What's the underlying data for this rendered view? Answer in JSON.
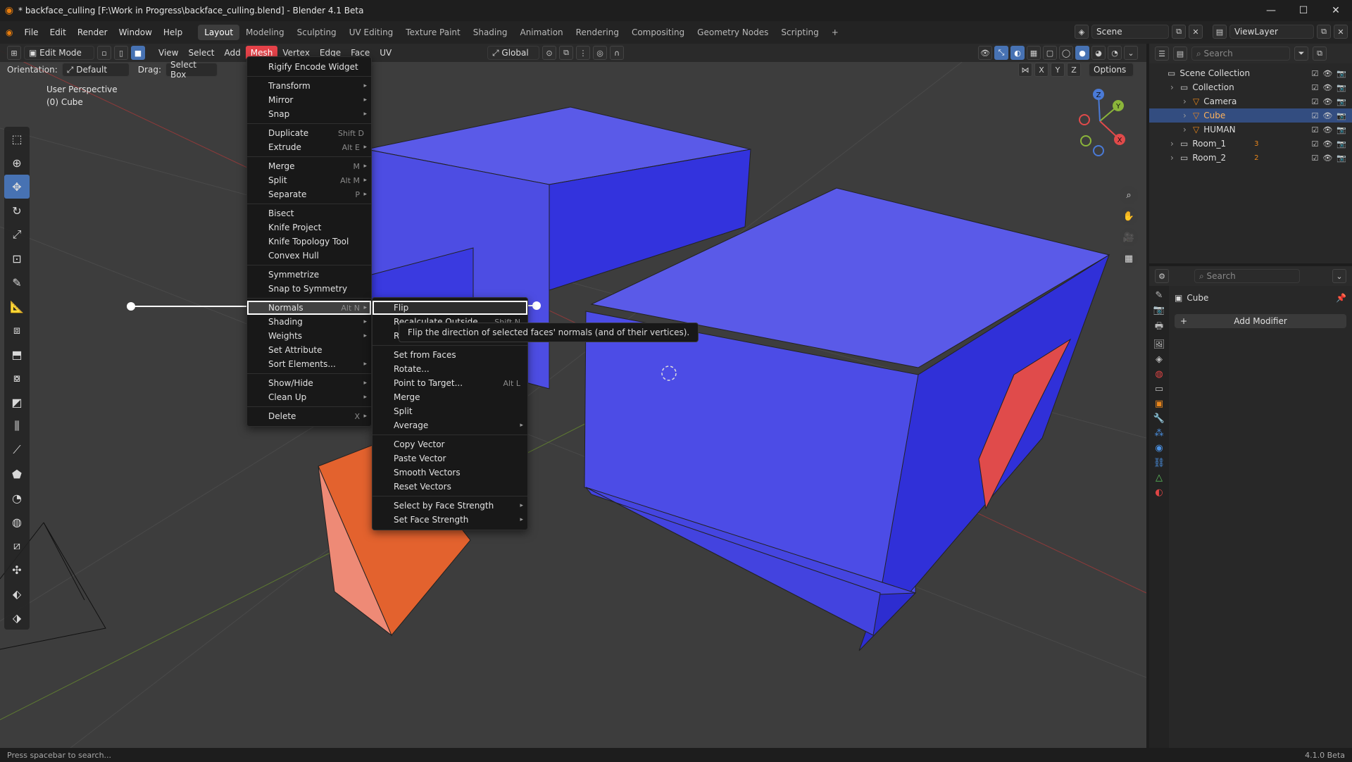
{
  "window": {
    "title": "* backface_culling [F:\\Work in Progress\\backface_culling.blend] - Blender 4.1 Beta"
  },
  "topmenu": [
    "File",
    "Edit",
    "Render",
    "Window",
    "Help"
  ],
  "workspaces": [
    "Layout",
    "Modeling",
    "Sculpting",
    "UV Editing",
    "Texture Paint",
    "Shading",
    "Animation",
    "Rendering",
    "Compositing",
    "Geometry Nodes",
    "Scripting",
    "+"
  ],
  "scene": {
    "name": "Scene",
    "view_layer": "ViewLayer"
  },
  "viewport_header": {
    "mode": "Edit Mode",
    "menus": [
      "View",
      "Select",
      "Add",
      "Mesh",
      "Vertex",
      "Edge",
      "Face",
      "UV"
    ],
    "transform": "Global",
    "orientation_label": "Orientation:",
    "orientation_value": "Default",
    "drag_label": "Drag:",
    "drag_value": "Select Box",
    "xyz": [
      "X",
      "Y",
      "Z"
    ],
    "options": "Options"
  },
  "viewport_info": {
    "line1": "User Perspective",
    "line2": "(0) Cube"
  },
  "gizmo": {
    "x": "X",
    "y": "Y",
    "z": "Z"
  },
  "mesh_menu": [
    {
      "label": "Rigify Encode Widget"
    },
    {
      "sep": true
    },
    {
      "label": "Transform",
      "sub": true
    },
    {
      "label": "Mirror",
      "sub": true
    },
    {
      "label": "Snap",
      "sub": true
    },
    {
      "sep": true
    },
    {
      "label": "Duplicate",
      "shortcut": "Shift D"
    },
    {
      "label": "Extrude",
      "shortcut": "Alt E",
      "sub": true
    },
    {
      "sep": true
    },
    {
      "label": "Merge",
      "shortcut": "M",
      "sub": true
    },
    {
      "label": "Split",
      "shortcut": "Alt M",
      "sub": true
    },
    {
      "label": "Separate",
      "shortcut": "P",
      "sub": true
    },
    {
      "sep": true
    },
    {
      "label": "Bisect"
    },
    {
      "label": "Knife Project"
    },
    {
      "label": "Knife Topology Tool"
    },
    {
      "label": "Convex Hull"
    },
    {
      "sep": true
    },
    {
      "label": "Symmetrize"
    },
    {
      "label": "Snap to Symmetry"
    },
    {
      "sep": true
    },
    {
      "label": "Normals",
      "shortcut": "Alt N",
      "sub": true,
      "active": true
    },
    {
      "label": "Shading",
      "sub": true
    },
    {
      "label": "Weights",
      "sub": true
    },
    {
      "label": "Set Attribute"
    },
    {
      "label": "Sort Elements...",
      "sub": true
    },
    {
      "sep": true
    },
    {
      "label": "Show/Hide",
      "sub": true
    },
    {
      "label": "Clean Up",
      "sub": true
    },
    {
      "sep": true
    },
    {
      "label": "Delete",
      "shortcut": "X",
      "sub": true
    }
  ],
  "normals_menu": [
    {
      "label": "Flip",
      "active": true
    },
    {
      "label": "Recalculate Outside",
      "shortcut": "Shift N"
    },
    {
      "label": "R"
    },
    {
      "sep": true
    },
    {
      "label": "Set from Faces"
    },
    {
      "label": "Rotate..."
    },
    {
      "label": "Point to Target...",
      "shortcut": "Alt L"
    },
    {
      "label": "Merge"
    },
    {
      "label": "Split"
    },
    {
      "label": "Average",
      "sub": true
    },
    {
      "sep": true
    },
    {
      "label": "Copy Vector"
    },
    {
      "label": "Paste Vector"
    },
    {
      "label": "Smooth Vectors"
    },
    {
      "label": "Reset Vectors"
    },
    {
      "sep": true
    },
    {
      "label": "Select by Face Strength",
      "sub": true
    },
    {
      "label": "Set Face Strength",
      "sub": true
    }
  ],
  "tooltip": "Flip the direction of selected faces' normals (and of their vertices).",
  "outliner": {
    "search_placeholder": "Search",
    "rows": [
      {
        "label": "Scene Collection",
        "indent": 0
      },
      {
        "label": "Collection",
        "indent": 1
      },
      {
        "label": "Camera",
        "indent": 2
      },
      {
        "label": "Cube",
        "indent": 2,
        "selected": true
      },
      {
        "label": "HUMAN",
        "indent": 2
      },
      {
        "label": "Room_1",
        "indent": 1,
        "badge": "3"
      },
      {
        "label": "Room_2",
        "indent": 1,
        "badge": "2"
      }
    ]
  },
  "properties": {
    "search_placeholder": "Search",
    "object_name": "Cube",
    "add_modifier": "Add Modifier"
  },
  "status": {
    "hint": "Press spacebar to search...",
    "version": "4.1.0 Beta"
  },
  "colors": {
    "accent": "#4772b3",
    "mesh_menu_active": "#e54249",
    "mesh_blue": "#4c4ce6",
    "mesh_orange": "#e3622e"
  }
}
